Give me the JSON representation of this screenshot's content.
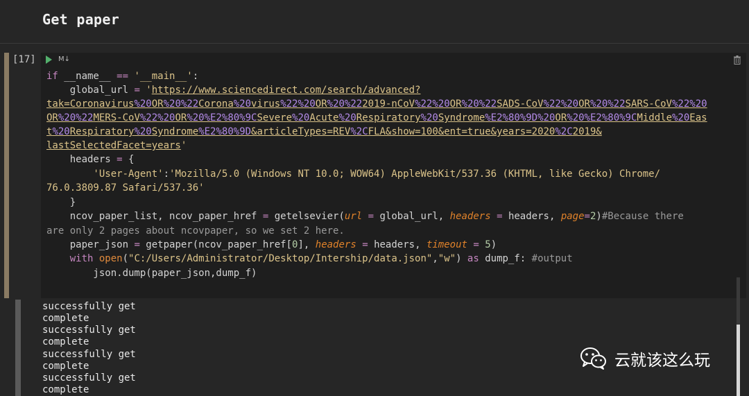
{
  "markdown_cell": {
    "title": "Get paper"
  },
  "code_cell": {
    "execution_count": "[17]",
    "cell_type_badge": "M↓",
    "lines": {
      "l1_if": "if",
      "l1_name": " __name__ ",
      "l1_eq": "==",
      "l1_main": " '__main__'",
      "l1_colon": ":",
      "l2_var": "    global_url ",
      "l2_eq": "=",
      "l2_quote_open": " '",
      "l2_url": "https://www.sciencedirect.com/search/advanced?",
      "l3_a": "tak=Coronavirus",
      "l3_b": "%20",
      "l3_c": "OR",
      "l3_d": "%20%22",
      "l3_e": "Corona",
      "l3_f": "%20",
      "l3_g": "virus",
      "l3_h": "%22%20",
      "l3_i": "OR",
      "l3_j": "%20%22",
      "l3_k": "2019-nCoV",
      "l3_l": "%22%20",
      "l3_m": "OR",
      "l3_n": "%20%22",
      "l3_o": "SADS-CoV",
      "l3_p": "%22%20",
      "l3_q": "OR",
      "l3_r": "%20%22",
      "l3_s": "SARS-CoV",
      "l3_t": "%22%20",
      "l4_a": "OR",
      "l4_b": "%20%22",
      "l4_c": "MERS-CoV",
      "l4_d": "%22%20",
      "l4_e": "OR",
      "l4_f": "%20%E2%80%9C",
      "l4_g": "Severe",
      "l4_h": "%20",
      "l4_i": "Acute",
      "l4_j": "%20",
      "l4_k": "Respiratory",
      "l4_l": "%20",
      "l4_m": "Syndrome",
      "l4_n": "%E2%80%9D%20",
      "l4_o": "OR",
      "l4_p": "%20%E2%80%9C",
      "l4_q": "Middle",
      "l4_r": "%20",
      "l4_s": "Eas",
      "l5_a": "t",
      "l5_b": "%20",
      "l5_c": "Respiratory",
      "l5_d": "%20",
      "l5_e": "Syndrome",
      "l5_f": "%E2%80%9D",
      "l5_g": "&articleTypes=REV",
      "l5_h": "%2C",
      "l5_i": "FLA&show=100&ent=true&years=2020",
      "l5_j": "%2C",
      "l5_k": "2019&",
      "l6_url": "lastSelectedFacet=years",
      "l6_quote": "'",
      "l7_headers": "    headers ",
      "l7_eq": "=",
      "l7_brace": " {",
      "l8_key": "        'User-Agent'",
      "l8_colon": ":",
      "l8_val": "'Mozilla/5.0 (Windows NT 10.0; WOW64) AppleWebKit/537.36 (KHTML, like Gecko) Chrome/",
      "l9_val": "76.0.3809.87 Safari/537.36'",
      "l10_close": "    }",
      "l11_a": "    ncov_paper_list, ncov_paper_href ",
      "l11_eq": "=",
      "l11_b": " getelsevier(",
      "l11_url": "url",
      "l11_eq2": " = ",
      "l11_c": "global_url, ",
      "l11_headers": "headers",
      "l11_eq3": " = ",
      "l11_d": "headers, ",
      "l11_page": "page",
      "l11_eq4": "=",
      "l11_num": "2",
      "l11_e": ")",
      "l11_cmt": "#Because there",
      "l12_cmt": "are only 2 pages about ncovpaper, so we set 2 here.",
      "l13_a": "    paper_json ",
      "l13_eq": "=",
      "l13_b": " getpaper(ncov_paper_href[",
      "l13_num": "0",
      "l13_c": "], ",
      "l13_headers": "headers",
      "l13_eq2": " = ",
      "l13_d": "headers, ",
      "l13_timeout": "timeout",
      "l13_eq3": " = ",
      "l13_num2": "5",
      "l13_e": ")",
      "l14_with": "    with",
      "l14_open": " open",
      "l14_a": "(",
      "l14_str1": "\"C:/Users/Administrator/Desktop/Intership/data.json\"",
      "l14_b": ",",
      "l14_str2": "\"w\"",
      "l14_c": ") ",
      "l14_as": "as",
      "l14_d": " dump_f: ",
      "l14_cmt": "#output",
      "l15": "        json.dump(paper_json,dump_f)"
    }
  },
  "output": {
    "lines": [
      "successfully get",
      "complete",
      "successfully get",
      "complete",
      "successfully get",
      "complete",
      "successfully get",
      "complete"
    ]
  },
  "watermark": {
    "text": "云就该这么玩",
    "icon": "wechat-icon"
  }
}
